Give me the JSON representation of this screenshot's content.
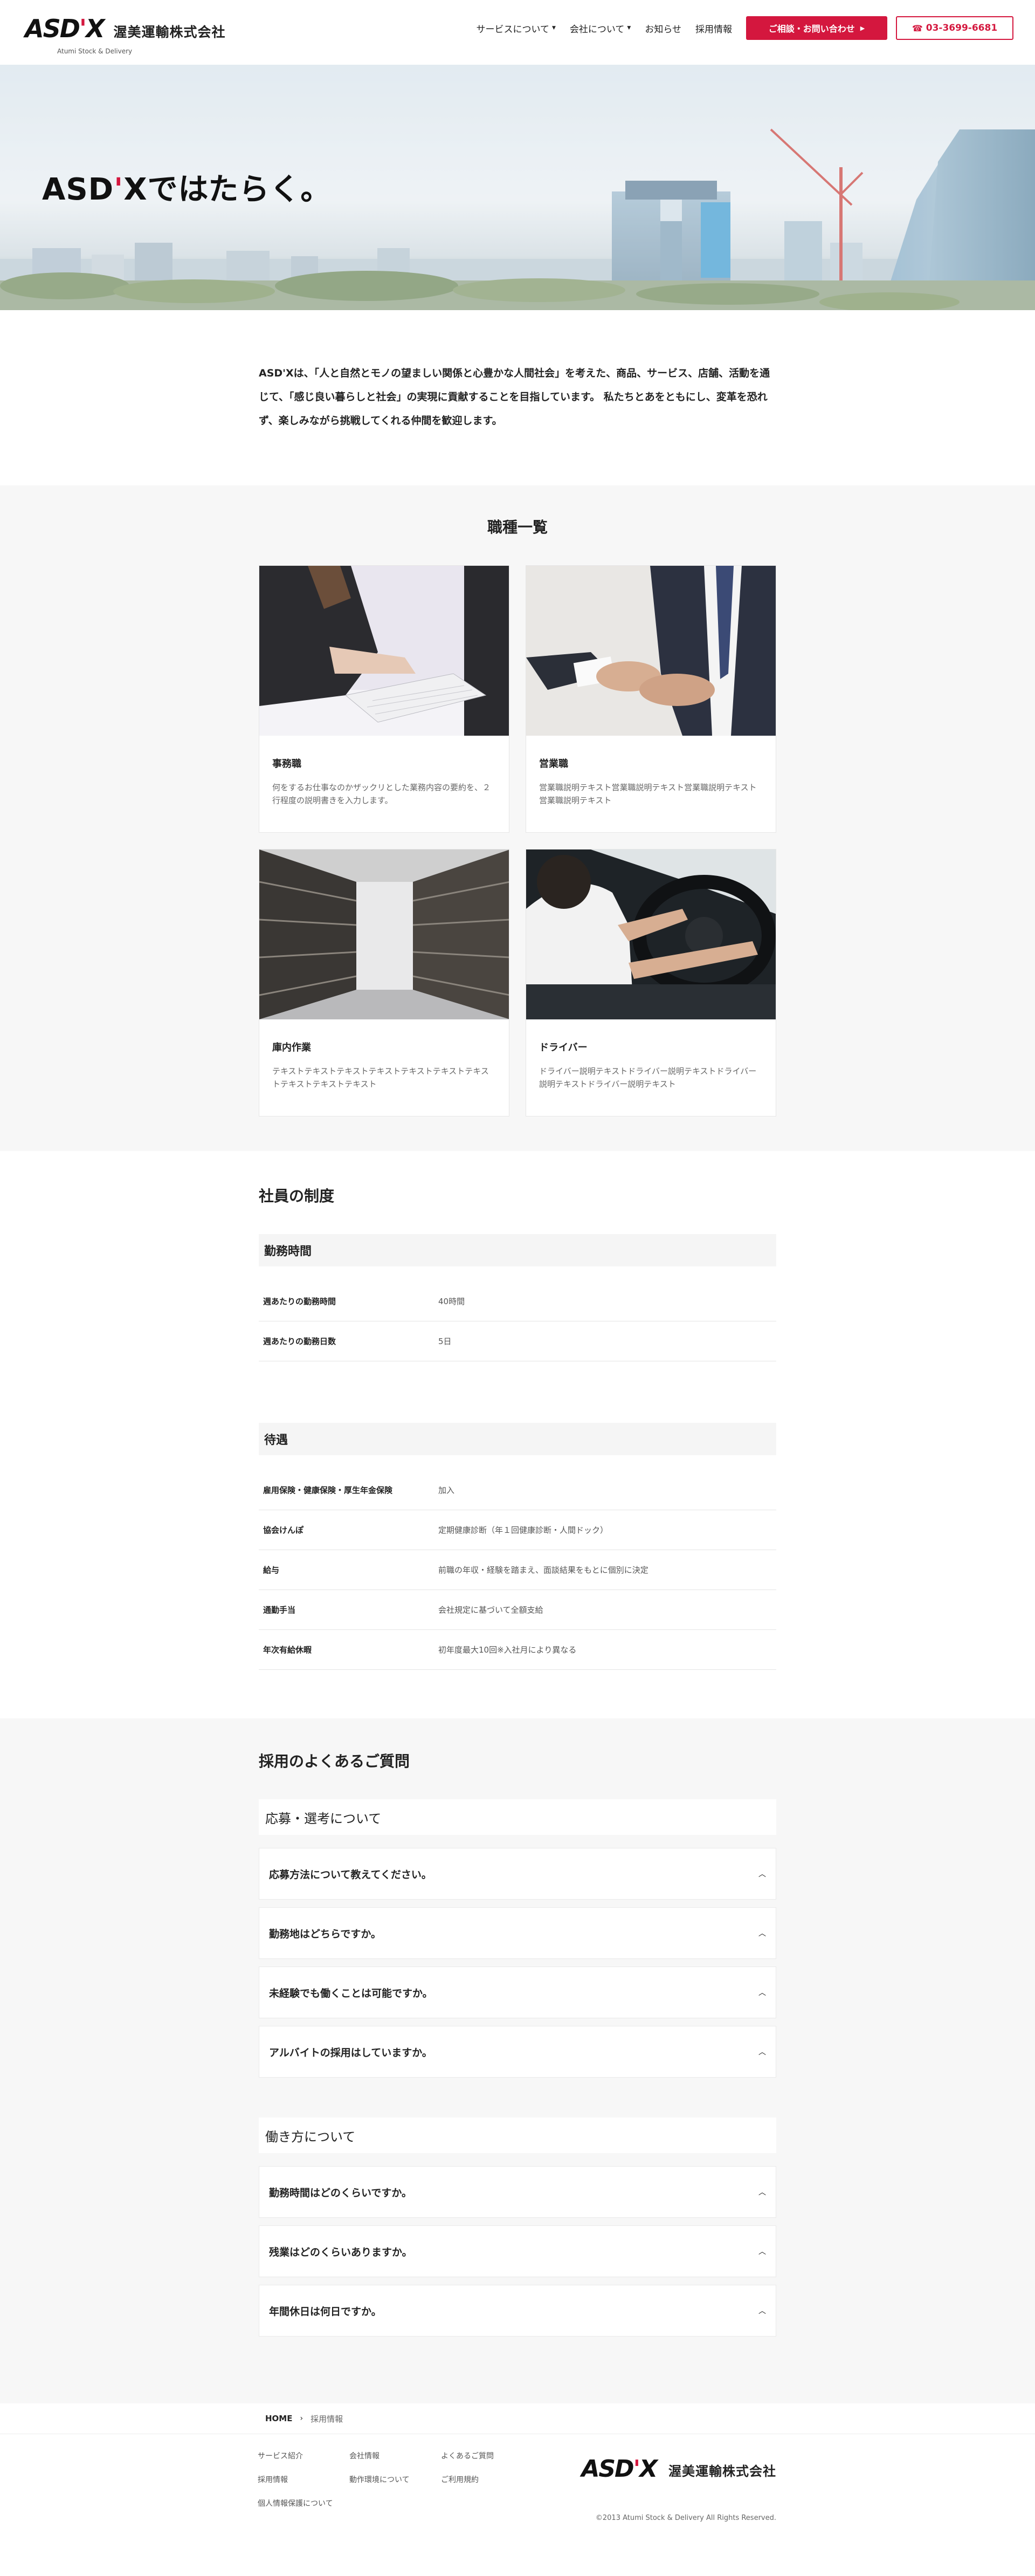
{
  "header": {
    "logo_main": "ASD",
    "logo_quote": "'",
    "logo_x": "X",
    "company": "渥美運輸株式会社",
    "logo_sub": "Atumi Stock & Delivery",
    "nav": [
      {
        "label": "サービスについて",
        "dropdown": true
      },
      {
        "label": "会社について",
        "dropdown": true
      },
      {
        "label": "お知らせ",
        "dropdown": false
      },
      {
        "label": "採用情報",
        "dropdown": false
      }
    ],
    "contact_label": "ご相談・お問い合わせ",
    "tel_label": "03-3699-6681"
  },
  "hero": {
    "title_a": "ASD",
    "title_q": "'",
    "title_b": "Xではたらく。"
  },
  "intro": {
    "text": "ASD'Xは、「人と自然とモノの望ましい関係と心豊かな人間社会」を考えた、商品、サービス、店舗、活動を通じて、「感じ良い暮らしと社会」の実現に貢献することを目指しています。 私たちとあをともにし、変革を恐れず、楽しみながら挑戦してくれる仲間を歓迎します。"
  },
  "jobs": {
    "title": "職種一覧",
    "items": [
      {
        "title": "事務職",
        "desc": "何をするお仕事なのかザックリとした業務内容の要約を、２行程度の説明書きを入力します。"
      },
      {
        "title": "営業職",
        "desc": "営業職説明テキスト営業職説明テキスト営業職説明テキスト営業職説明テキスト"
      },
      {
        "title": "庫内作業",
        "desc": "テキストテキストテキストテキストテキストテキストテキストテキストテキストテキスト"
      },
      {
        "title": "ドライバー",
        "desc": "ドライバー説明テキストドライバー説明テキストドライバー説明テキストドライバー説明テキスト"
      }
    ]
  },
  "system": {
    "title": "社員の制度",
    "work": {
      "heading": "勤務時間",
      "rows": [
        {
          "k": "週あたりの勤務時間",
          "v": "40時間"
        },
        {
          "k": "週あたりの勤務日数",
          "v": "5日"
        }
      ]
    },
    "benefits": {
      "heading": "待遇",
      "rows": [
        {
          "k": "雇用保険・健康保険・厚生年金保険",
          "v": "加入"
        },
        {
          "k": "協会けんぽ",
          "v": "定期健康診断（年１回健康診断・人間ドック）"
        },
        {
          "k": "給与",
          "v": "前職の年収・経験を踏まえ、面談結果をもとに個別に決定"
        },
        {
          "k": "通勤手当",
          "v": "会社規定に基づいて全額支給"
        },
        {
          "k": "年次有給休暇",
          "v": "初年度最大10回※入社月により異なる"
        }
      ]
    }
  },
  "faq": {
    "title": "採用のよくあるご質問",
    "groups": [
      {
        "category": "応募・選考について",
        "items": [
          "応募方法について教えてください。",
          "勤務地はどちらですか。",
          "未経験でも働くことは可能ですか。",
          "アルバイトの採用はしていますか。"
        ]
      },
      {
        "category": "働き方について",
        "items": [
          "勤務時間はどのくらいですか。",
          "残業はどのくらいありますか。",
          "年間休日は何日ですか。"
        ]
      }
    ]
  },
  "breadcrumb": {
    "home": "HOME",
    "current": "採用情報"
  },
  "footer": {
    "links": [
      "サービス紹介",
      "会社情報",
      "よくあるご質問",
      "採用情報",
      "動作環境について",
      "ご利用規約",
      "個人情報保護について"
    ],
    "company": "渥美運輸株式会社",
    "copyright": "©2013 Atumi Stock & Delivery All Rights Reserved."
  },
  "colors": {
    "accent": "#d4173e",
    "section_bg": "#f7f7f7"
  },
  "icons": {
    "chevron": "chevron-up-icon",
    "phone": "phone-icon",
    "arrow": "triangle-right-icon"
  }
}
